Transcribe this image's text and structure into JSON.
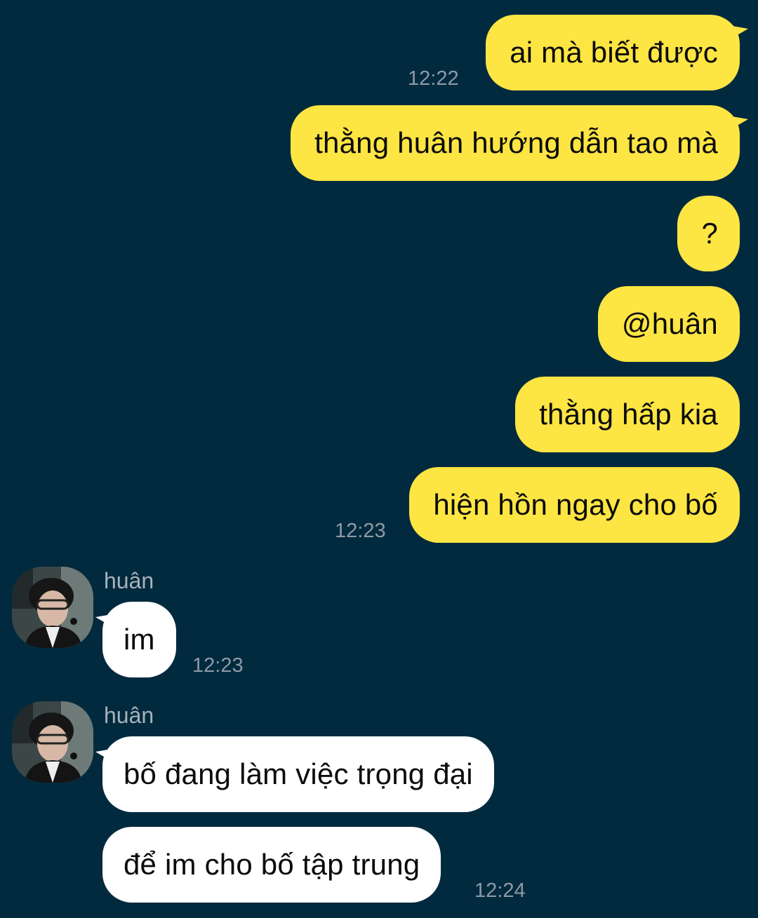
{
  "theme": {
    "background": "#022a3e",
    "outgoing_bubble": "#fde543",
    "incoming_bubble": "#ffffff",
    "timestamp_color": "#8c9aa6",
    "sender_name_color": "#a7b2bb"
  },
  "chat": {
    "outgoing": [
      {
        "text": "ai mà biết được",
        "time": "12:22"
      },
      {
        "text": "thằng huân hướng dẫn tao mà"
      },
      {
        "text": "?"
      },
      {
        "text": "@huân"
      },
      {
        "text": "thằng hấp kia"
      },
      {
        "text": "hiện hồn ngay cho bố",
        "time": "12:23"
      }
    ],
    "incoming_groups": [
      {
        "sender": "huân",
        "avatar_icon": "user-avatar-photo",
        "messages": [
          {
            "text": "im",
            "time": "12:23"
          }
        ]
      },
      {
        "sender": "huân",
        "avatar_icon": "user-avatar-photo",
        "messages": [
          {
            "text": "bố đang làm việc trọng đại"
          },
          {
            "text": "để im cho bố tập trung",
            "time": "12:24"
          }
        ]
      }
    ]
  }
}
